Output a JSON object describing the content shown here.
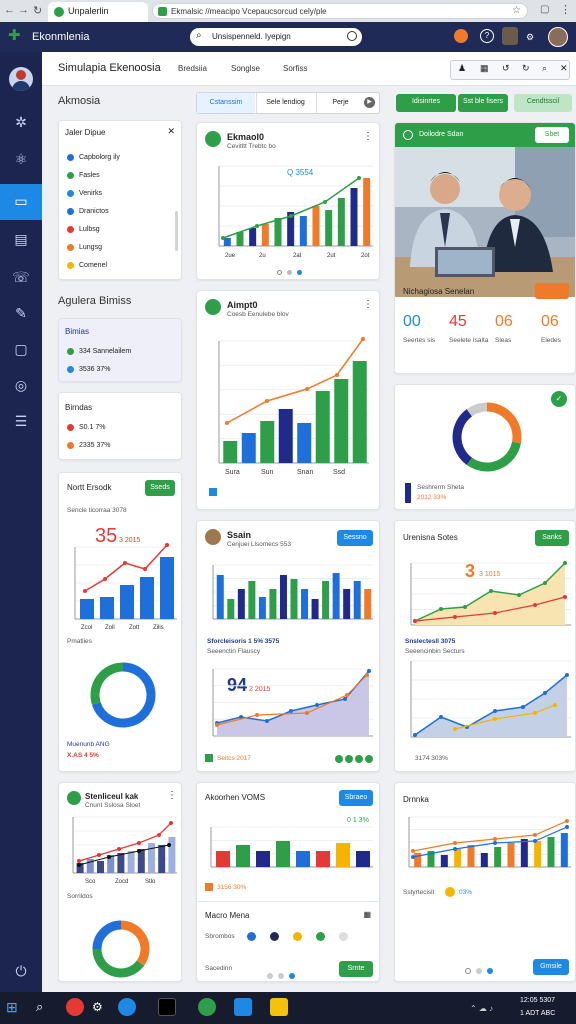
{
  "browser": {
    "tab_title": "Unpalerlin",
    "url": "Ekmalsic //meacipo Vcepaucsorcud cely/ple"
  },
  "app": {
    "title": "Ekonmlenia",
    "search_placeholder": "Unsispenneld. Iyepign"
  },
  "topbar": {
    "title": "Simulapia Ekenoosia",
    "tabs": [
      "Bredsiia",
      "Songlse",
      "Sorfiss"
    ]
  },
  "left": {
    "section_title": "Akmosia",
    "filter": {
      "title": "Jaler Dipue",
      "items": [
        {
          "label": "Capbolorg ily",
          "color": "#1e6fd9"
        },
        {
          "label": "Fasles",
          "color": "#2e9e48"
        },
        {
          "label": "Venirks",
          "color": "#1e88e5"
        },
        {
          "label": "Dranictos",
          "color": "#1e6fd9"
        },
        {
          "label": "Lulbsg",
          "color": "#e53935"
        },
        {
          "label": "Lungsg",
          "color": "#ee7a2a"
        },
        {
          "label": "Comenel",
          "color": "#f4b400"
        }
      ]
    },
    "section2_title": "Agulera Bimiss",
    "stat1": {
      "title": "Bimias",
      "rows": [
        "334 Sannelailem",
        "3536 37%"
      ]
    },
    "stat2": {
      "title": "Birndas",
      "rows": [
        "S0.1 7%",
        "2335 37%"
      ]
    }
  },
  "buttons": {
    "seg": [
      "Cstanssim",
      "Sele lendiog",
      "Perje"
    ],
    "green1": "Idisinrtes",
    "green2": "Sst ble fisers",
    "green3": "Cendtsscil"
  },
  "cards": {
    "c1": {
      "title": "Ekmaol0",
      "sub": "Cevitltt Trebtc bo",
      "badge": "Q 3554"
    },
    "c2": {
      "title": "Aimpt0",
      "sub": "Coesb Eenulebe blov",
      "x_labels": [
        "Sura",
        "Sun",
        "Snan",
        "Ssd"
      ]
    },
    "c3": {
      "title": "Doilodre Sdan",
      "button": "Sbet"
    },
    "c4": {
      "title": "Nichagiosa Senelan",
      "stats": [
        {
          "value": "00",
          "color": "#1e88e5",
          "label": "Seertes sis"
        },
        {
          "value": "45",
          "color": "#e53935",
          "label": "Seelete Isalta"
        },
        {
          "value": "06",
          "color": "#ee7a2a",
          "label": "Sleas"
        },
        {
          "value": "06",
          "color": "#ee7a2a",
          "label": "Eledes"
        }
      ]
    },
    "c5": {
      "legend": [
        "Seshrerm Sheta",
        "2012 33%"
      ]
    },
    "c6": {
      "title": "Nortt Ersodk",
      "button": "Sseds",
      "sub": "Sencle ticorraa 3078",
      "big": "35",
      "big_sub": "3 2015",
      "x_labels": [
        "Zcol",
        "Zoll",
        "Zott",
        "Zilis"
      ],
      "legend_title": "Pmatlies",
      "foot1": "Muenunb ANG",
      "foot2": "X.AS 4 5%"
    },
    "c7": {
      "title": "Ssain",
      "sub": "Cenjuei Llsomecs 553",
      "button": "Sessno",
      "sub2": "Sforcleisoris 1 5% 3575",
      "sub3": "Seeenctin Flauscy",
      "big": "94",
      "big_sub": "2 2015",
      "foot": "Seitcs 2017"
    },
    "c8": {
      "title": "Urenisna Sotes",
      "button": "Sanks",
      "big": "3",
      "big_sub": "3 1015",
      "sub2": "Snslectesll 3075",
      "sub3": "Seeencinbin Secturs",
      "foot": "3174 303%"
    },
    "c9": {
      "title": "Stenliceul kak",
      "sub": "Cnunt Sslosa Sloet",
      "x_labels": [
        "Sco",
        "Zocd",
        "Stlo"
      ],
      "foot_label": "Sorrildos"
    },
    "c10": {
      "title": "Akoorhen VOMS",
      "button": "Sbraeo",
      "badge": "0 1 3%",
      "legend": "3156 30%",
      "list_title": "Macro Mena",
      "list_label": "Sbrombos",
      "foot_label": "Sacedinn",
      "foot_btn": "Srnte"
    },
    "c11": {
      "title": "Drnnka",
      "sub": "Sstyrtecisll",
      "badge": "03%",
      "foot_btn": "Gmsile"
    }
  },
  "taskbar": {
    "time": "12:05 5307",
    "date": "1 ADT ABC"
  },
  "colors": {
    "navy": "#1f2a56",
    "green": "#2e9e48",
    "blue": "#1e88e5",
    "orange": "#ee7a2a",
    "red": "#e53935"
  }
}
